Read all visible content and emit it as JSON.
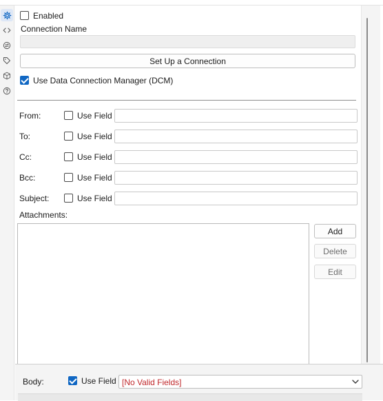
{
  "sidebar": {
    "icons": [
      {
        "name": "settings-icon",
        "active": true
      },
      {
        "name": "code-icon",
        "active": false
      },
      {
        "name": "connector-icon",
        "active": false
      },
      {
        "name": "tag-icon",
        "active": false
      },
      {
        "name": "package-icon",
        "active": false
      },
      {
        "name": "help-icon",
        "active": false
      }
    ]
  },
  "config": {
    "enabled_label": "Enabled",
    "enabled_checked": false,
    "connection_name_label": "Connection Name",
    "connection_name_value": "",
    "setup_button_label": "Set Up a Connection",
    "dcm_label": "Use Data Connection Manager (DCM)",
    "dcm_checked": true
  },
  "fields": [
    {
      "label": "From:",
      "use_field_label": "Use Field",
      "checked": false,
      "value": ""
    },
    {
      "label": "To:",
      "use_field_label": "Use Field",
      "checked": false,
      "value": ""
    },
    {
      "label": "Cc:",
      "use_field_label": "Use Field",
      "checked": false,
      "value": ""
    },
    {
      "label": "Bcc:",
      "use_field_label": "Use Field",
      "checked": false,
      "value": ""
    },
    {
      "label": "Subject:",
      "use_field_label": "Use Field",
      "checked": false,
      "value": ""
    }
  ],
  "attachments": {
    "label": "Attachments:",
    "add_label": "Add",
    "delete_label": "Delete",
    "edit_label": "Edit"
  },
  "body": {
    "label": "Body:",
    "use_field_label": "Use Field",
    "use_field_checked": true,
    "selected": "[No Valid Fields]"
  },
  "colors": {
    "accent": "#1067c3",
    "invalid_text": "#c0282b"
  }
}
